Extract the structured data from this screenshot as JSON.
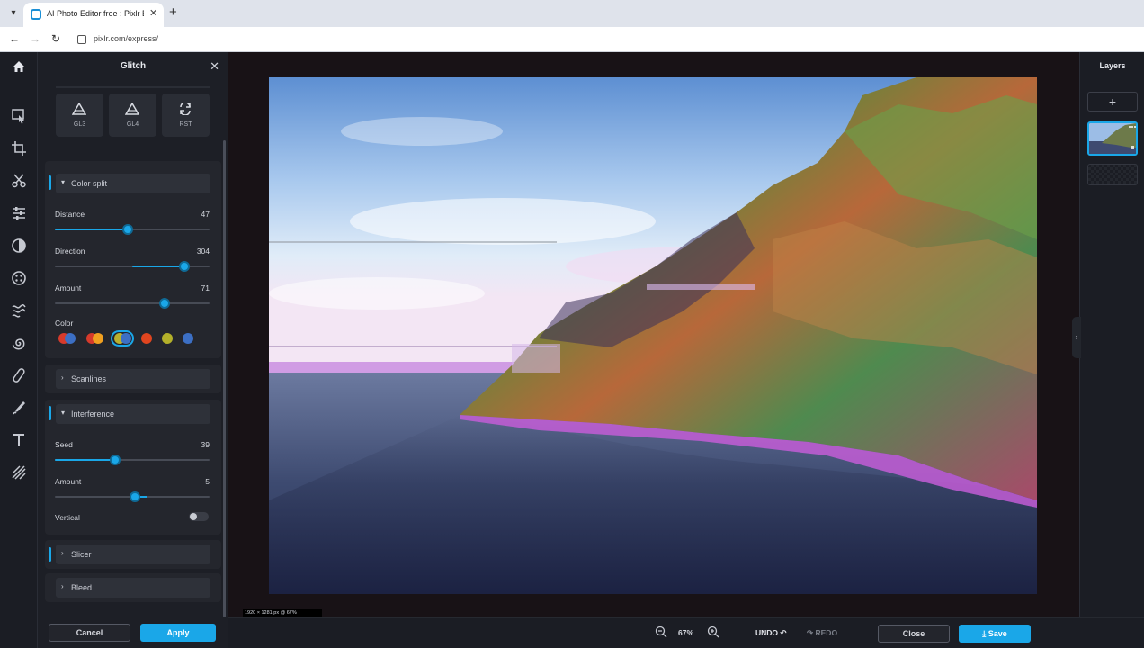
{
  "browser": {
    "tab_title": "AI Photo Editor free : Pixlr Expr",
    "url": "pixlr.com/express/"
  },
  "panel": {
    "title": "Glitch",
    "presets": [
      {
        "label": "GL3"
      },
      {
        "label": "GL4"
      },
      {
        "label": "RST"
      }
    ],
    "color_split": {
      "label": "Color split",
      "distance": {
        "label": "Distance",
        "value": "47",
        "fraction": 0.47
      },
      "direction": {
        "label": "Direction",
        "value": "304",
        "fraction": 0.84,
        "start": 0.5
      },
      "amount": {
        "label": "Amount",
        "value": "71",
        "fraction": 0.71,
        "start": 0.71
      },
      "color_label": "Color",
      "colors": [
        [
          "#d63a2b",
          "#3c6fc4"
        ],
        [
          "#d63a2b",
          "#f0a020"
        ],
        [
          "#b9b02e",
          "#3c6fc4"
        ],
        [
          "#e0451f"
        ],
        [
          "#b3b02a"
        ],
        [
          "#3c6fc4"
        ]
      ],
      "selected_color": 2
    },
    "scanlines": {
      "label": "Scanlines"
    },
    "interference": {
      "label": "Interference",
      "seed": {
        "label": "Seed",
        "value": "39",
        "fraction": 0.39
      },
      "amount": {
        "label": "Amount",
        "value": "5",
        "fraction": 0.52,
        "start": 0.52,
        "end": 0.6
      },
      "vertical": {
        "label": "Vertical",
        "on": false
      }
    },
    "slicer": {
      "label": "Slicer"
    },
    "bleed": {
      "label": "Bleed"
    },
    "cancel_label": "Cancel",
    "apply_label": "Apply"
  },
  "canvas": {
    "dimensions_text": "1920 × 1281 px @ 67%"
  },
  "layers": {
    "title": "Layers"
  },
  "bottombar": {
    "zoom": "67%",
    "undo": "UNDO",
    "redo": "REDO",
    "close": "Close",
    "save": "Save"
  },
  "colors": {
    "accent": "#1aa7e8",
    "panel_bg": "#1d1f26"
  }
}
